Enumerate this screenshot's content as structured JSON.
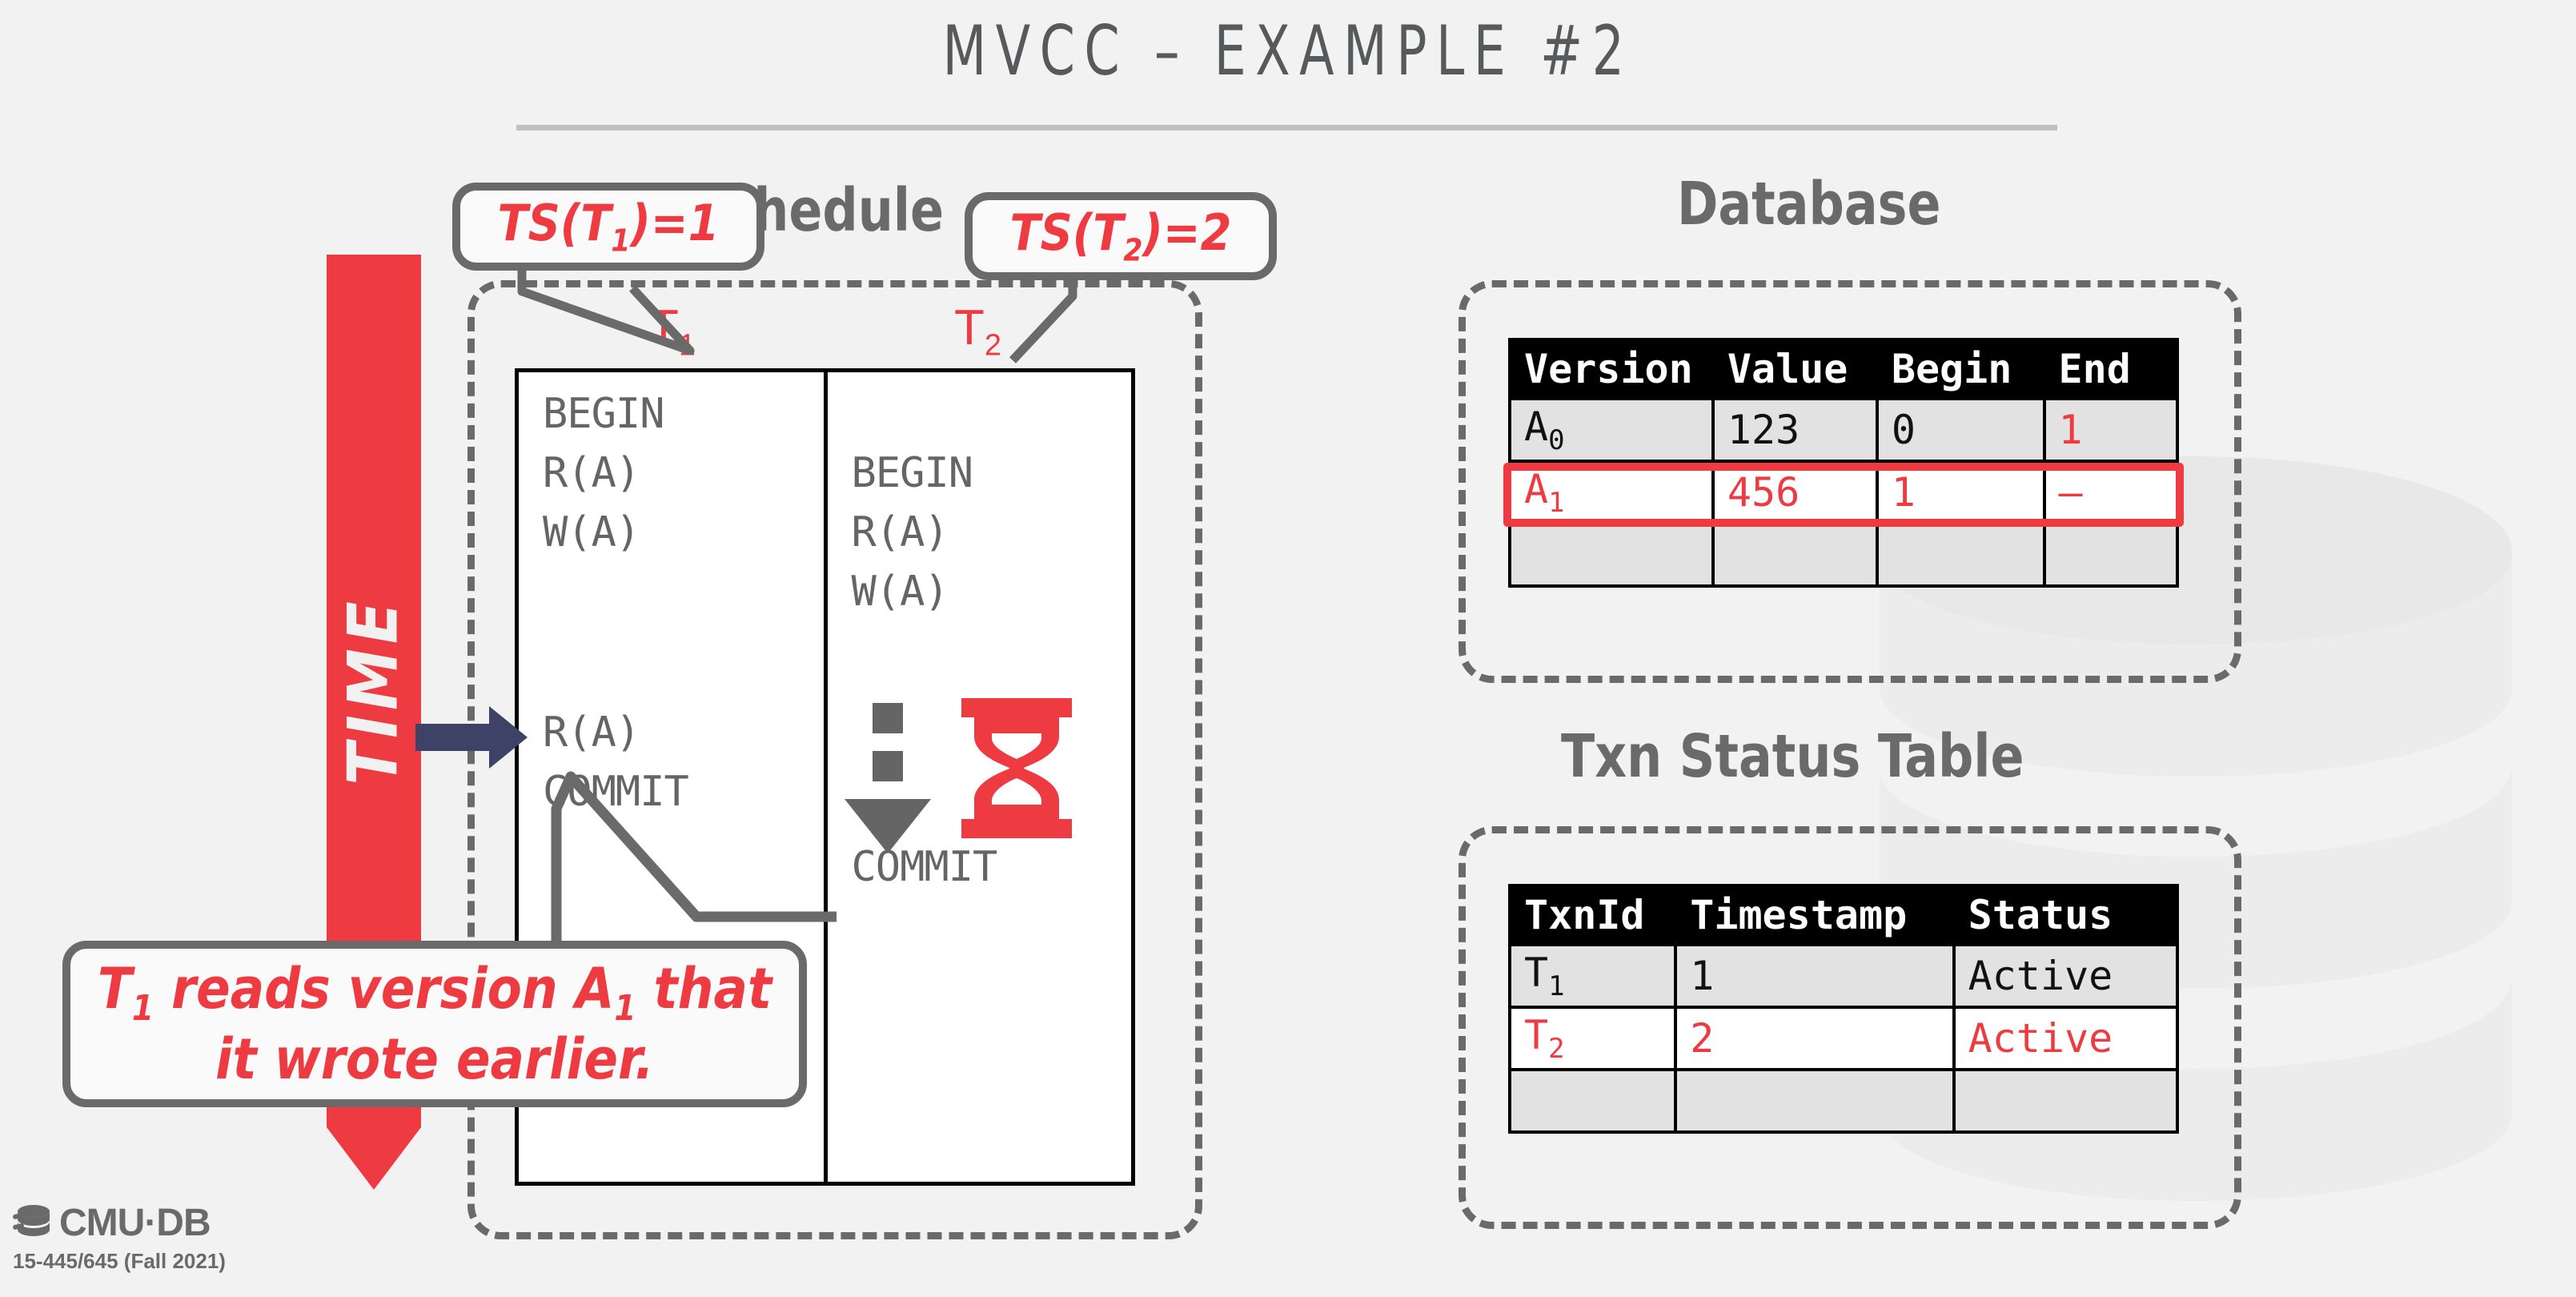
{
  "slide": {
    "title": "MVCC – EXAMPLE #2"
  },
  "sections": {
    "schedule_heading": "Schedule",
    "database_heading": "Database",
    "txn_status_heading": "Txn Status Table"
  },
  "time_axis": {
    "label": "TIME",
    "color": "#ee3b42"
  },
  "schedule": {
    "columns": [
      {
        "label": "T",
        "subscript": "1",
        "color": "#ee3b42"
      },
      {
        "label": "T",
        "subscript": "2",
        "color": "#ee3b42"
      }
    ],
    "t1_ops": [
      "BEGIN",
      "R(A)",
      "W(A)",
      "R(A)",
      "COMMIT"
    ],
    "t2_ops": [
      "BEGIN",
      "R(A)",
      "W(A)",
      "COMMIT"
    ],
    "wait_icon": "hourglass-icon",
    "cursor_icon": "navy-right-arrow-icon"
  },
  "callouts": {
    "ts1": "TS(T₁)=1",
    "ts1_parts": {
      "prefix": "TS(T",
      "sub": "1",
      "suffix": ")=1"
    },
    "ts2_parts": {
      "prefix": "TS(T",
      "sub": "2",
      "suffix": ")=2"
    },
    "note_line1_a": "T",
    "note_line1_sub": "1",
    "note_line1_b": " reads version A",
    "note_line1_sub2": "1",
    "note_line1_c": " that",
    "note_line2": "it wrote earlier.",
    "color": "#ee3b42"
  },
  "database_table": {
    "headers": [
      "Version",
      "Value",
      "Begin",
      "End"
    ],
    "rows": [
      {
        "version": "A",
        "version_sub": "0",
        "value": "123",
        "begin": "0",
        "end": "1",
        "highlight": false,
        "end_red": true
      },
      {
        "version": "A",
        "version_sub": "1",
        "value": "456",
        "begin": "1",
        "end": "–",
        "highlight": true,
        "end_red": true
      },
      {
        "version": "",
        "version_sub": "",
        "value": "",
        "begin": "",
        "end": "",
        "highlight": false,
        "end_red": false
      }
    ]
  },
  "txn_status_table": {
    "headers": [
      "TxnId",
      "Timestamp",
      "Status"
    ],
    "rows": [
      {
        "txnid": "T",
        "txnid_sub": "1",
        "timestamp": "1",
        "status": "Active",
        "highlight": false
      },
      {
        "txnid": "T",
        "txnid_sub": "2",
        "timestamp": "2",
        "status": "Active",
        "highlight": true
      },
      {
        "txnid": "",
        "txnid_sub": "",
        "timestamp": "",
        "status": "",
        "highlight": false
      }
    ]
  },
  "footer": {
    "logo_text": "CMU·DB",
    "course": "15-445/645 (Fall 2021)",
    "logo_icon": "database-cylinder-icon"
  }
}
